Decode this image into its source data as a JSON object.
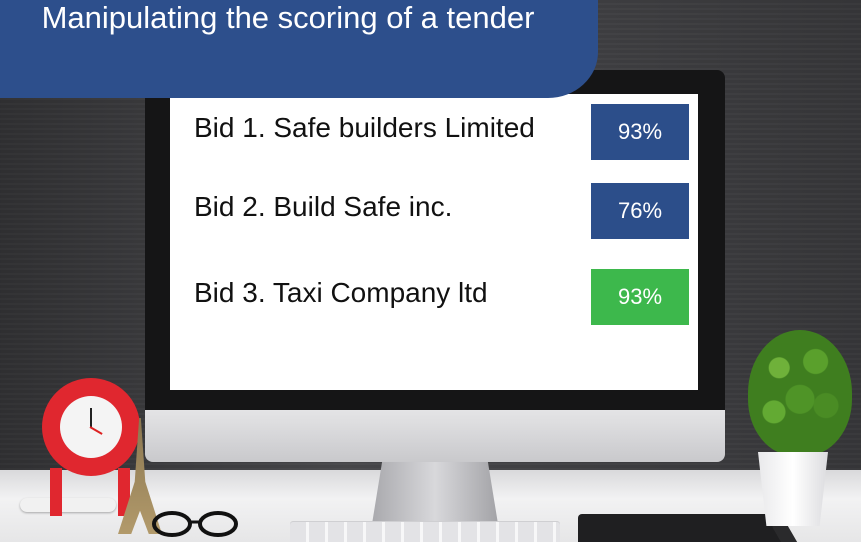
{
  "title": "Manipulating the scoring of a tender",
  "bids": [
    {
      "label": "Bid 1. Safe builders Limited",
      "score": "9̴​3%",
      "score_display": "93%",
      "color": "#2c4e8a"
    },
    {
      "label": "Bid 2. Build Safe inc.",
      "score_display": "76%",
      "color": "#2c4e8a"
    },
    {
      "label": "Bid 3. Taxi Company ltd",
      "score_display": "93%",
      "color": "#3db84c"
    }
  ],
  "colors": {
    "banner": "#2d4f8c",
    "score_blue": "#2c4e8a",
    "score_green": "#3db84c"
  }
}
